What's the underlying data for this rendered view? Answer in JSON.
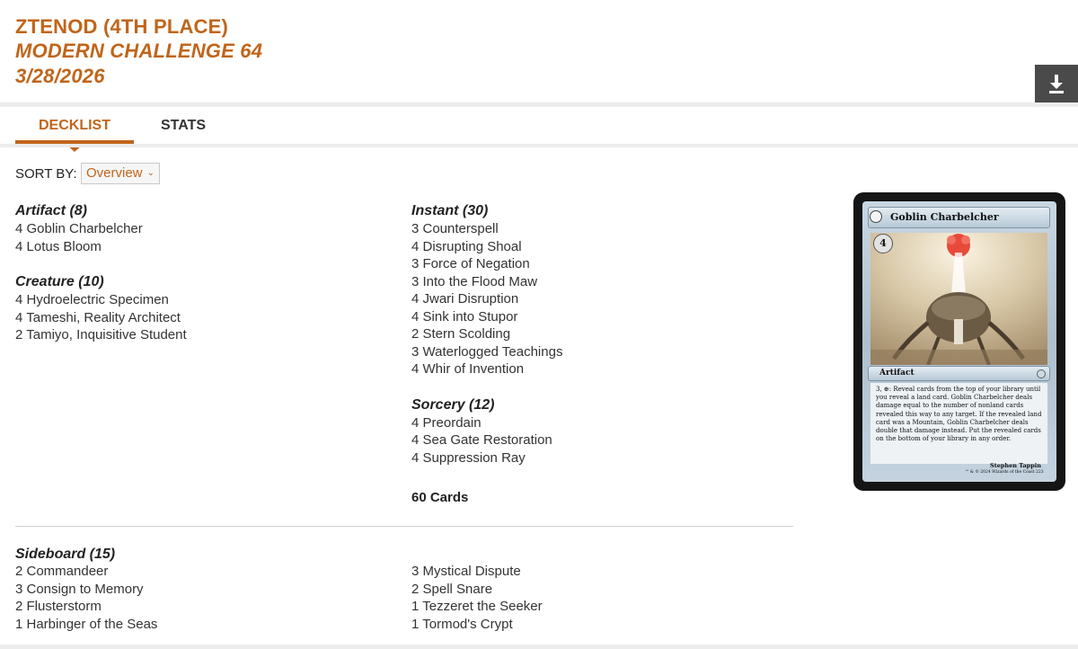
{
  "header": {
    "player": "ZTENOD (4TH PLACE)",
    "event": "MODERN CHALLENGE 64",
    "date": "3/28/2026"
  },
  "tabs": [
    {
      "label": "DECKLIST",
      "active": true
    },
    {
      "label": "STATS",
      "active": false
    }
  ],
  "sort": {
    "label": "SORT BY:",
    "value": "Overview"
  },
  "colors": {
    "accent": "#c0651a",
    "text": "#333333",
    "download_bg": "#4a4a4a"
  },
  "icons": {
    "download": "download-icon",
    "dropdown": "chevron-down-icon"
  },
  "main_left": [
    {
      "heading": "Artifact (8)",
      "cards": [
        "4 Goblin Charbelcher",
        "4 Lotus Bloom"
      ]
    },
    {
      "heading": "Creature (10)",
      "cards": [
        "4 Hydroelectric Specimen",
        "4 Tameshi, Reality Architect",
        "2 Tamiyo, Inquisitive Student"
      ]
    }
  ],
  "main_right": [
    {
      "heading": "Instant (30)",
      "cards": [
        "3 Counterspell",
        "4 Disrupting Shoal",
        "3 Force of Negation",
        "3 Into the Flood Maw",
        "4 Jwari Disruption",
        "4 Sink into Stupor",
        "2 Stern Scolding",
        "3 Waterlogged Teachings",
        "4 Whir of Invention"
      ]
    },
    {
      "heading": "Sorcery (12)",
      "cards": [
        "4 Preordain",
        "4 Sea Gate Restoration",
        "4 Suppression Ray"
      ]
    }
  ],
  "total": "60 Cards",
  "sideboard": {
    "heading": "Sideboard (15)",
    "left": [
      "2 Commandeer",
      "3 Consign to Memory",
      "2 Flusterstorm",
      "1 Harbinger of the Seas"
    ],
    "right": [
      "3 Mystical Dispute",
      "2 Spell Snare",
      "1 Tezzeret the Seeker",
      "1 Tormod's Crypt"
    ]
  },
  "card_preview": {
    "name": "Goblin Charbelcher",
    "cost": "4",
    "type": "Artifact",
    "rules_text": "3, ⊕: Reveal cards from the top of your library until you reveal a land card. Goblin Charbelcher deals damage equal to the number of nonland cards revealed this way to any target. If the revealed land card was a Mountain, Goblin Charbelcher deals double that damage instead. Put the revealed cards on the bottom of your library in any order.",
    "artist": "Stephen Tappin",
    "copyright": "™ & © 2024 Wizards of the Coast 223"
  }
}
